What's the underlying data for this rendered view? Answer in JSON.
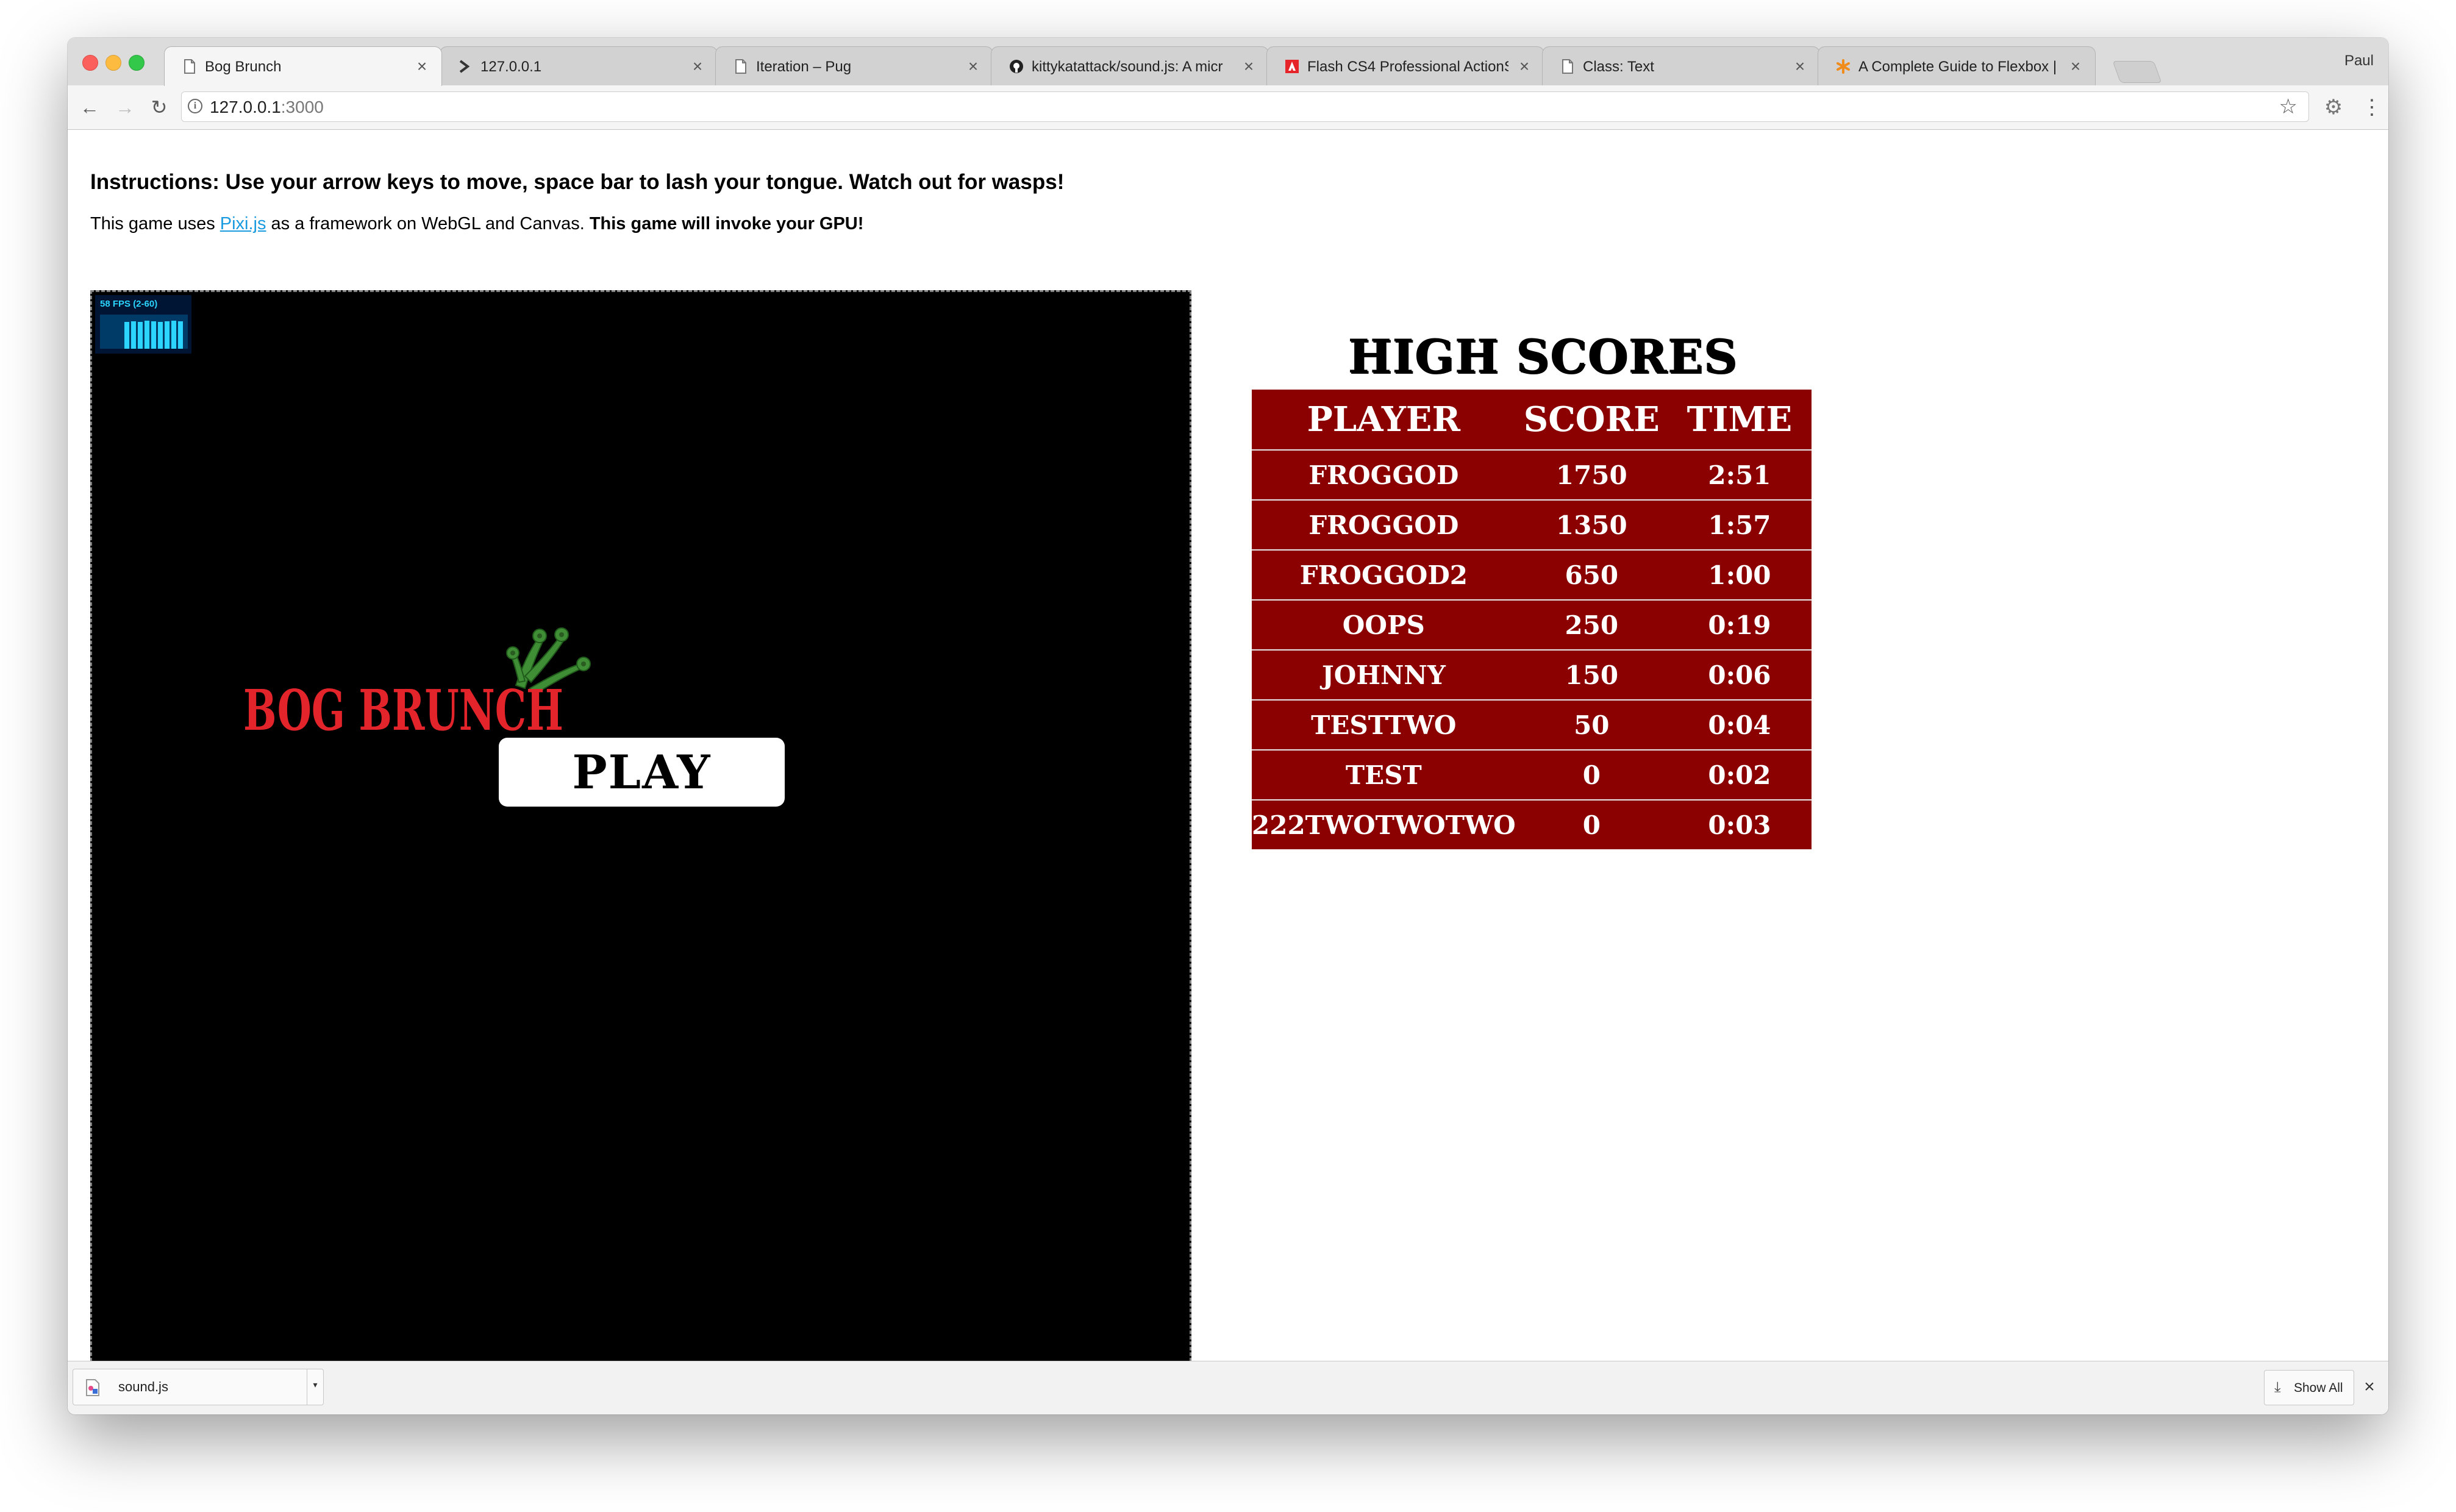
{
  "browser": {
    "tabs": [
      {
        "title": "Bog Brunch",
        "icon": "document-icon",
        "active": true
      },
      {
        "title": "127.0.0.1",
        "icon": "terminal-icon",
        "active": false
      },
      {
        "title": "Iteration – Pug",
        "icon": "document-icon",
        "active": false
      },
      {
        "title": "kittykatattack/sound.js: A micr",
        "icon": "github-icon",
        "active": false
      },
      {
        "title": "Flash CS4 Professional ActionS",
        "icon": "adobe-icon",
        "active": false
      },
      {
        "title": "Class: Text",
        "icon": "document-icon",
        "active": false
      },
      {
        "title": "A Complete Guide to Flexbox | C",
        "icon": "asterisk-icon",
        "active": false
      }
    ],
    "profile_name": "Paul",
    "url_host": "127.0.0.1",
    "url_port": ":3000"
  },
  "page": {
    "instructions": "Instructions: Use your arrow keys to move, space bar to lash your tongue. Watch out for wasps!",
    "framework_prefix": "This game uses ",
    "framework_link": "Pixi.js",
    "framework_middle": " as a framework on WebGL and Canvas. ",
    "framework_warning": "This game will invoke your GPU!"
  },
  "game": {
    "fps_text": "58 FPS (2-60)",
    "fps_bars": [
      0.78,
      0.8,
      0.78,
      0.82,
      0.8,
      0.78,
      0.8,
      0.82,
      0.8
    ],
    "logo_text": "BOG BRUNCH",
    "play_label": "PLAY",
    "colors": {
      "logo": "#e3242b",
      "frog": "#3f8e36",
      "canvas": "#000000"
    }
  },
  "high_scores": {
    "title": "HIGH SCORES",
    "headers": [
      "PLAYER",
      "SCORE",
      "TIME"
    ],
    "rows": [
      {
        "player": "FROGGOD",
        "score": "1750",
        "time": "2:51"
      },
      {
        "player": "FROGGOD",
        "score": "1350",
        "time": "1:57"
      },
      {
        "player": "FROGGOD2",
        "score": "650",
        "time": "1:00"
      },
      {
        "player": "OOPS",
        "score": "250",
        "time": "0:19"
      },
      {
        "player": "JOHNNY",
        "score": "150",
        "time": "0:06"
      },
      {
        "player": "TESTTWO",
        "score": "50",
        "time": "0:04"
      },
      {
        "player": "TEST",
        "score": "0",
        "time": "0:02"
      },
      {
        "player": "222TWOTWOTWO",
        "score": "0",
        "time": "0:03"
      }
    ],
    "colors": {
      "background": "#8b0000",
      "text": "#ffffff"
    }
  },
  "downloads": {
    "file_name": "sound.js",
    "show_all_label": "Show All"
  }
}
